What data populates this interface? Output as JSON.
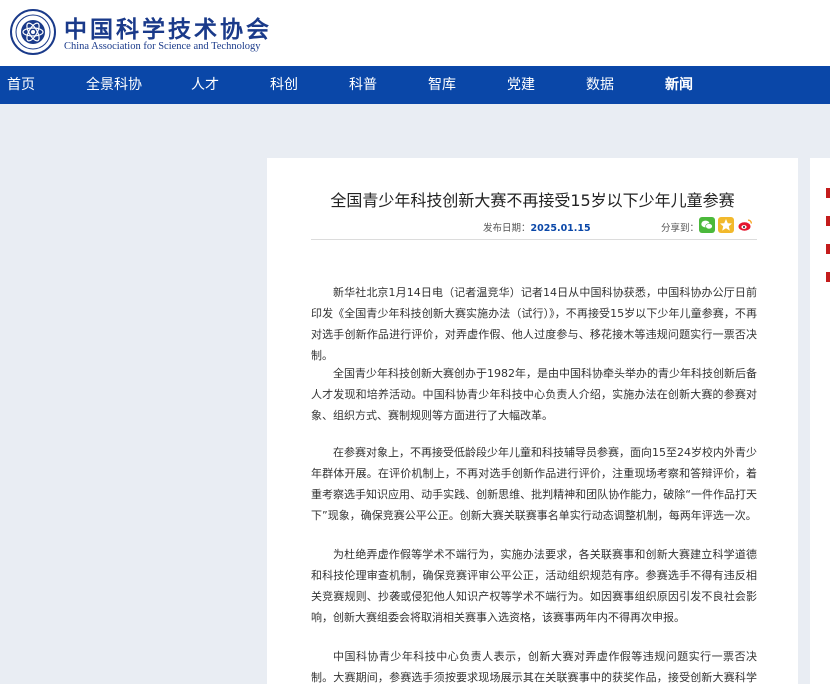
{
  "header": {
    "logo_cn": "中国科学技术协会",
    "logo_en": "China Association for Science and Technology"
  },
  "nav": [
    {
      "label": "首页"
    },
    {
      "label": "全景科协"
    },
    {
      "label": "人才"
    },
    {
      "label": "科创"
    },
    {
      "label": "科普"
    },
    {
      "label": "智库"
    },
    {
      "label": "党建"
    },
    {
      "label": "数据"
    },
    {
      "label": "新闻"
    }
  ],
  "article": {
    "title": "全国青少年科技创新大赛不再接受15岁以下少年儿童参赛",
    "date_label": "发布日期：",
    "date": "2025.01.15",
    "share_label": "分享到：",
    "paragraphs": [
      "新华社北京1月14日电（记者温竞华）记者14日从中国科协获悉，中国科协办公厅日前印发《全国青少年科技创新大赛实施办法（试行）》，不再接受15岁以下少年儿童参赛，不再对选手创新作品进行评价，对弄虚作假、他人过度参与、移花接木等违规问题实行一票否决制。",
      "全国青少年科技创新大赛创办于1982年，是由中国科协牵头举办的青少年科技创新后备人才发现和培养活动。中国科协青少年科技中心负责人介绍，实施办法在创新大赛的参赛对象、组织方式、赛制规则等方面进行了大幅改革。",
      "在参赛对象上，不再接受低龄段少年儿童和科技辅导员参赛，面向15至24岁校内外青少年群体开展。在评价机制上，不再对选手创新作品进行评价，注重现场考察和答辩评价，着重考察选手知识应用、动手实践、创新思维、批判精神和团队协作能力，破除“一件作品打天下”现象，确保竞赛公平公正。创新大赛关联赛事名单实行动态调整机制，每两年评选一次。",
      "为杜绝弄虚作假等学术不端行为，实施办法要求，各关联赛事和创新大赛建立科学道德和科技伦理审查机制，确保竞赛评审公平公正，活动组织规范有序。参赛选手不得有违反相关竞赛规则、抄袭或侵犯他人知识产权等学术不端行为。如因赛事组织原因引发不良社会影响，创新大赛组委会将取消相关赛事入选资格，该赛事两年内不得再次申报。",
      "中国科协青少年科技中心负责人表示，创新大赛对弄虚作假等违规问题实行一票否决制。大赛期间，参赛选手须按要求现场展示其在关联赛事中的获奖作品，接受创新大赛科学道德和伦理审查。"
    ]
  },
  "colors": {
    "nav_bg": "#0a47a8",
    "brand": "#1a3a8a",
    "page_bg": "#e9edf3"
  }
}
